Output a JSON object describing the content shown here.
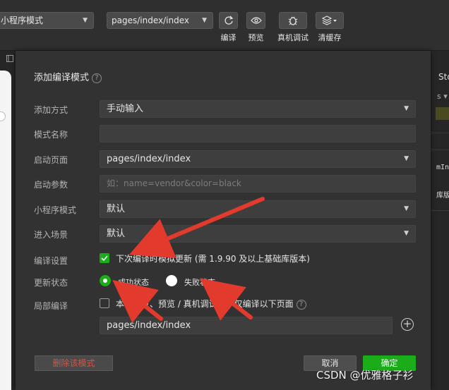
{
  "toolbar": {
    "mode_select": "小程序模式",
    "page_select": "pages/index/index",
    "compile_label": "编译",
    "preview_label": "预览",
    "remote_debug_label": "真机调试",
    "clear_cache_label": "清缓存"
  },
  "right_panel": {
    "text1": "Sto",
    "text2": "s ▾",
    "text3": "mIn",
    "text4": "库版"
  },
  "dialog": {
    "title": "添加编译模式",
    "rows": {
      "add_method": {
        "label": "添加方式",
        "value": "手动输入"
      },
      "mode_name": {
        "label": "模式名称",
        "value": ""
      },
      "start_page": {
        "label": "启动页面",
        "value": "pages/index/index"
      },
      "start_params": {
        "label": "启动参数",
        "placeholder": "如：name=vendor&color=black"
      },
      "mini_mode": {
        "label": "小程序模式",
        "value": "默认"
      },
      "scene": {
        "label": "进入场景",
        "value": "默认"
      },
      "compile_settings": {
        "label": "编译设置",
        "checkbox_text": "下次编译时模拟更新 (需 1.9.90 及以上基础库版本)",
        "checked": true
      },
      "update_state": {
        "label": "更新状态",
        "success_text": "成功状态",
        "fail_text": "失败状态",
        "selected": "成功状态"
      },
      "partial_compile": {
        "label": "局部编译",
        "checkbox_text": "本地开发、预览 / 真机调试时，仅编译以下页面",
        "checked": false,
        "page_value": "pages/index/index"
      }
    },
    "delete_button": "删除该模式",
    "cancel_button": "取消",
    "confirm_button": "确定"
  },
  "colors": {
    "accent": "#1aad19",
    "danger": "#e0503f",
    "arrow": "#e23a2c"
  },
  "watermark": "CSDN @优雅格子衫"
}
